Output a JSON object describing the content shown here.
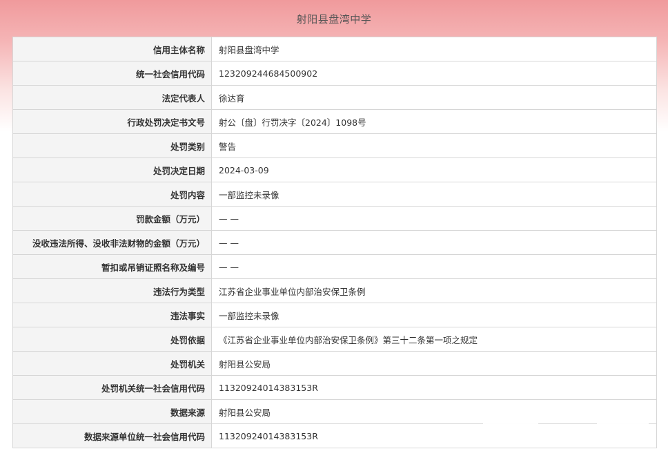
{
  "page_title": "射阳县盘湾中学",
  "rows": [
    {
      "label": "信用主体名称",
      "value": "射阳县盘湾中学"
    },
    {
      "label": "统一社会信用代码",
      "value": "123209244684500902"
    },
    {
      "label": "法定代表人",
      "value": "徐达育"
    },
    {
      "label": "行政处罚决定书文号",
      "value": "射公〔盘〕行罚决字〔2024〕1098号"
    },
    {
      "label": "处罚类别",
      "value": "警告"
    },
    {
      "label": "处罚决定日期",
      "value": "2024-03-09"
    },
    {
      "label": "处罚内容",
      "value": "一部监控未录像"
    },
    {
      "label": "罚款金额（万元）",
      "value": "— —"
    },
    {
      "label": "没收违法所得、没收非法财物的金额（万元）",
      "value": "— —"
    },
    {
      "label": "暂扣或吊销证照名称及编号",
      "value": "— —"
    },
    {
      "label": "违法行为类型",
      "value": "江苏省企业事业单位内部治安保卫条例"
    },
    {
      "label": "违法事实",
      "value": "一部监控未录像"
    },
    {
      "label": "处罚依据",
      "value": "《江苏省企业事业单位内部治安保卫条例》第三十二条第一项之规定"
    },
    {
      "label": "处罚机关",
      "value": "射阳县公安局"
    },
    {
      "label": "处罚机关统一社会信用代码",
      "value": "11320924014383153R"
    },
    {
      "label": "数据来源",
      "value": "射阳县公安局"
    },
    {
      "label": "数据来源单位统一社会信用代码",
      "value": "11320924014383153R"
    }
  ]
}
